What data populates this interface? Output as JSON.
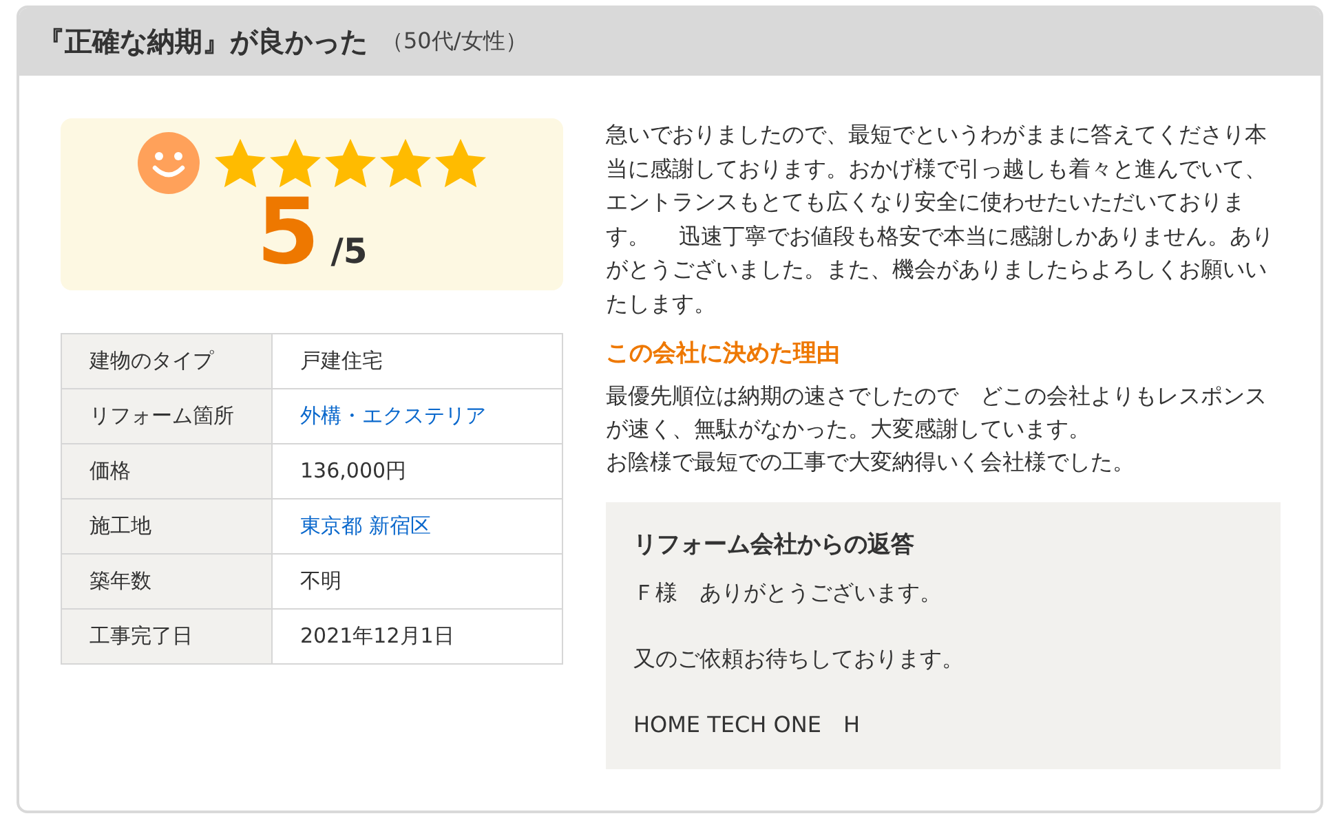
{
  "header": {
    "title": "『正確な納期』が良かった",
    "reviewer": "（50代/女性）"
  },
  "rating": {
    "stars": 5,
    "score": "5",
    "out_of": "/5"
  },
  "details": [
    {
      "label": "建物のタイプ",
      "value": "戸建住宅",
      "kind": "text"
    },
    {
      "label": "リフォーム箇所",
      "value": "外構・エクステリア",
      "kind": "link"
    },
    {
      "label": "価格",
      "value": "136,000円",
      "kind": "text"
    },
    {
      "label": "施工地",
      "value": "東京都 新宿区",
      "kind": "link"
    },
    {
      "label": "築年数",
      "value": "不明",
      "kind": "text"
    },
    {
      "label": "工事完了日",
      "value": "2021年12月1日",
      "kind": "text"
    }
  ],
  "comment": "急いでおりましたので、最短でというわがままに答えてくださり本当に感謝しております。おかげ様で引っ越しも着々と進んでいて、エントランスもとても広くなり安全に使わせたいただいております。　 迅速丁寧でお値段も格安で本当に感謝しかありません。ありがとうございました。また、機会がありましたらよろしくお願いいたします。",
  "reason": {
    "heading": "この会社に決めた理由",
    "paragraphs": [
      "最優先順位は納期の速さでしたので　どこの会社よりもレスポンスが速く、無駄がなかった。大変感謝しています。",
      "お陰様で最短での工事で大変納得いく会社様でした。"
    ]
  },
  "reply": {
    "heading": "リフォーム会社からの返答",
    "paragraphs": [
      "Ｆ様　ありがとうございます。",
      "又のご依頼お待ちしております。",
      "HOME TECH ONE　H"
    ]
  }
}
